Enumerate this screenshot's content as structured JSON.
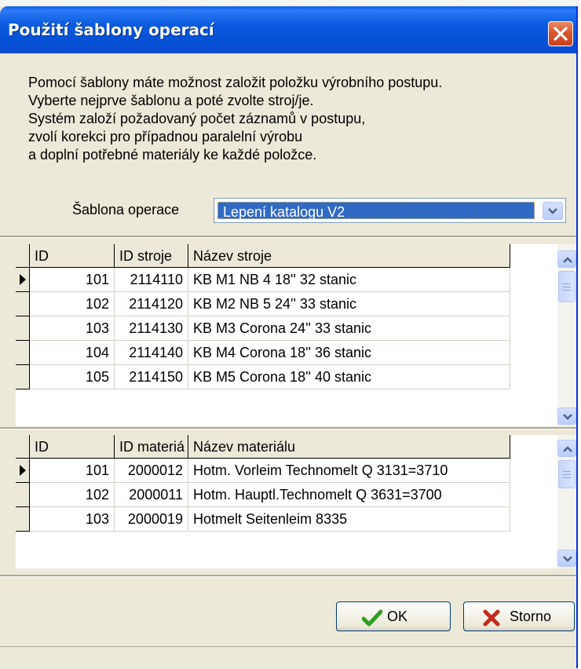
{
  "window": {
    "title": "Použití šablony operací"
  },
  "info_lines": [
    "Pomocí šablony máte možnost založit položku výrobního postupu.",
    "Vyberte nejprve šablonu a poté zvolte stroj/je.",
    "Systém založí požadovaný počet záznamů v postupu,",
    "zvolí korekci pro případnou paralelní výrobu",
    "a doplní potřebné materiály ke každé položce."
  ],
  "template": {
    "label": "Šablona operace",
    "value": "Lepení katalogu V2"
  },
  "machines_grid": {
    "columns": [
      "ID",
      "ID stroje",
      "Název stroje"
    ],
    "rows": [
      {
        "id": "101",
        "code": "2114110",
        "name": "KB M1 NB 4 18'' 32 stanic"
      },
      {
        "id": "102",
        "code": "2114120",
        "name": "KB M2 NB 5 24'' 33 stanic"
      },
      {
        "id": "103",
        "code": "2114130",
        "name": "KB M3 Corona 24'' 33 stanic"
      },
      {
        "id": "104",
        "code": "2114140",
        "name": "KB M4 Corona 18'' 36 stanic"
      },
      {
        "id": "105",
        "code": "2114150",
        "name": "KB M5 Corona 18'' 40 stanic"
      }
    ]
  },
  "materials_grid": {
    "columns": [
      "ID",
      "ID materiá",
      "Název materiálu"
    ],
    "rows": [
      {
        "id": "101",
        "code": "2000012",
        "name": "Hotm. Vorleim Technomelt Q 3131=3710"
      },
      {
        "id": "102",
        "code": "2000011",
        "name": "Hotm. Hauptl.Technomelt Q 3631=3700"
      },
      {
        "id": "103",
        "code": "2000019",
        "name": "Hotmelt Seitenleim 8335"
      }
    ]
  },
  "buttons": {
    "ok": "OK",
    "cancel": "Storno"
  },
  "colors": {
    "titlebar": "#0a5ae0",
    "selection": "#316ac5",
    "dialog_bg": "#ece9d8",
    "ok_check": "#2e9e1e",
    "cancel_x": "#c42b1c"
  },
  "icons": {
    "close": "close-icon",
    "ok": "check-icon",
    "cancel": "x-icon",
    "dropdown": "chevron-down-icon",
    "row_pointer": "row-pointer-icon"
  }
}
